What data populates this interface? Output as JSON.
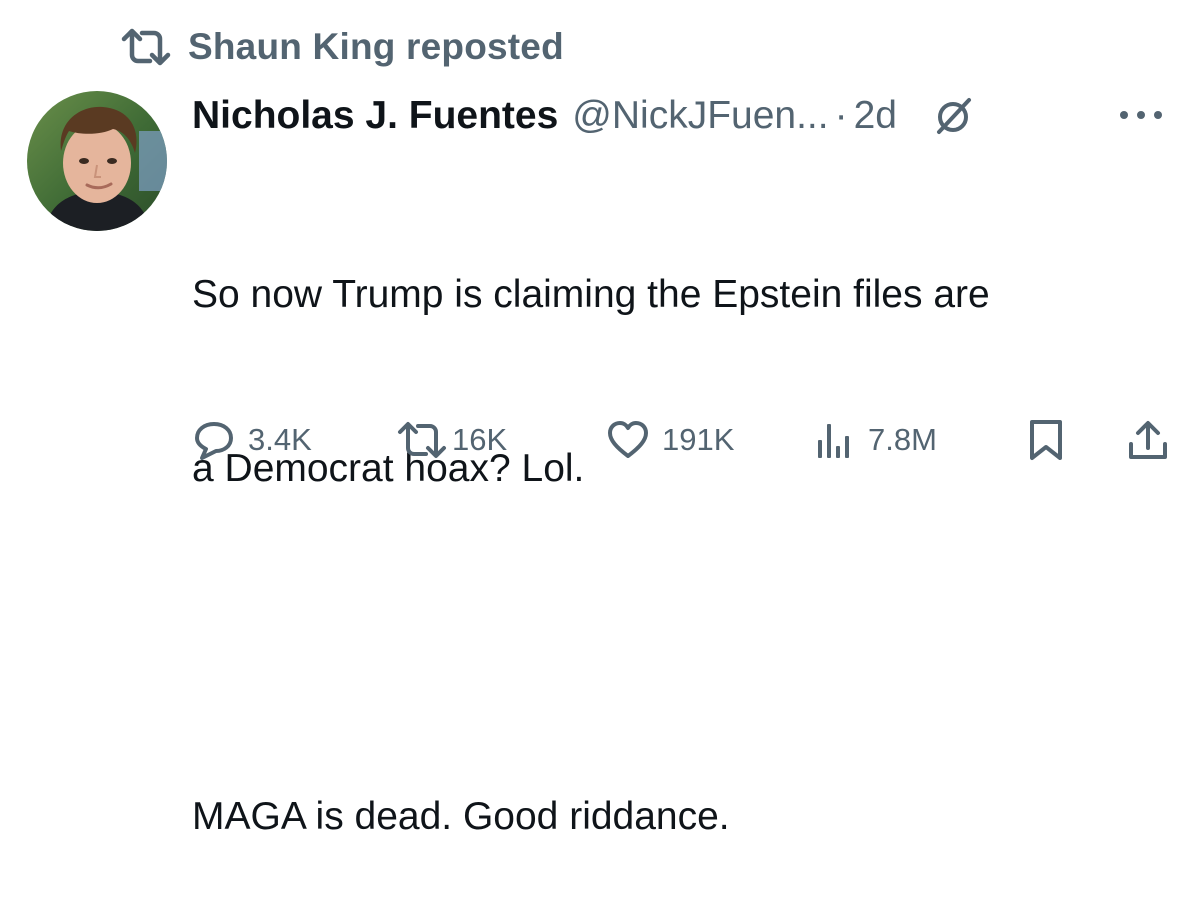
{
  "repost": {
    "label": "Shaun King reposted"
  },
  "author": {
    "display_name": "Nicholas J. Fuentes",
    "handle": "@NickJFuen...",
    "separator": "·",
    "time": "2d"
  },
  "tweet": {
    "line1": "So now Trump is claiming the Epstein files are",
    "line2": "a Democrat hoax? Lol.",
    "line3": "",
    "line4": "MAGA is dead. Good riddance."
  },
  "actions": {
    "replies": "3.4K",
    "reposts": "16K",
    "likes": "191K",
    "views": "7.8M"
  },
  "icons": {
    "repost": "repost-icon",
    "grok": "grok-icon",
    "more": "more-icon",
    "reply": "reply-icon",
    "like": "heart-icon",
    "views": "views-icon",
    "bookmark": "bookmark-icon",
    "share": "share-icon"
  },
  "colors": {
    "text_primary": "#0f1419",
    "text_secondary": "#536471",
    "background": "#ffffff"
  }
}
